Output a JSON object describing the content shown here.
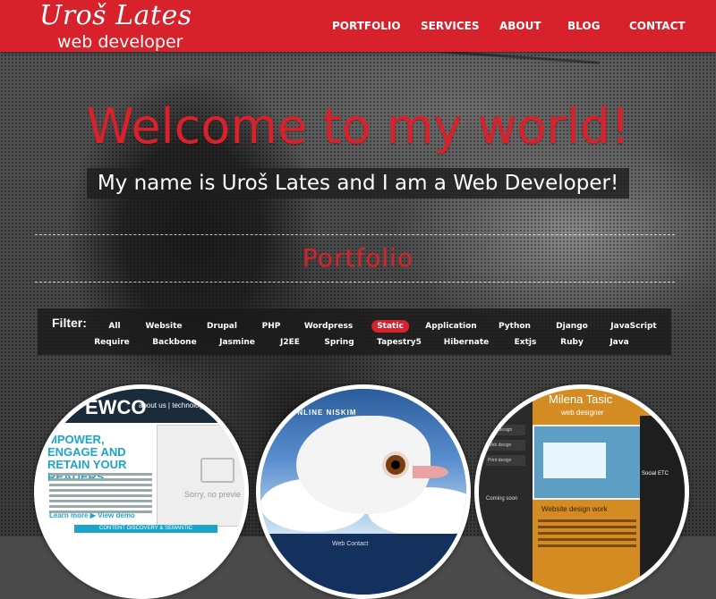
{
  "logo": {
    "name": "Uroš Lates",
    "subtitle": "web developer"
  },
  "nav": {
    "items": [
      "PORTFOLIO",
      "SERVICES",
      "ABOUT",
      "BLOG",
      "CONTACT"
    ]
  },
  "hero": {
    "headline": "Welcome to my world!",
    "subline": "My name is Uroš Lates and I am a Web Developer!"
  },
  "portfolio": {
    "title": "Portfolio"
  },
  "filter": {
    "label": "Filter:",
    "row1": [
      "All",
      "Website",
      "Drupal",
      "PHP",
      "Wordpress",
      "Static",
      "Application",
      "Python",
      "Django",
      "JavaScript"
    ],
    "row2": [
      "Require",
      "Backbone",
      "Jasmine",
      "J2EE",
      "Spring",
      "Tapestry5",
      "Hibernate",
      "Extjs",
      "Ruby",
      "Java"
    ],
    "active": "Static"
  },
  "thumbs": {
    "one": {
      "brand": "EWCO",
      "nav": "about us | technology |",
      "hero": "MPOWER, ENGAGE AND RETAIN YOUR READERS",
      "video_msg": "Sorry, no previe",
      "links": "Learn more  ▶ View demo",
      "bottom": "CONTENT DISCOVERY & SEMANTIC"
    },
    "two": {
      "banner": "T ONLINE NISKIM",
      "footer": "Web Contact"
    },
    "three": {
      "name": "Milena Tasic",
      "role": "web designer",
      "menu": [
        "Logo design",
        "Web design",
        "Print design"
      ],
      "coming": "Coming soon",
      "social": "Social ETC",
      "text": "Website design work"
    }
  },
  "colors": {
    "brand_red": "#d7212b",
    "dark_overlay": "#1e1e1e"
  }
}
